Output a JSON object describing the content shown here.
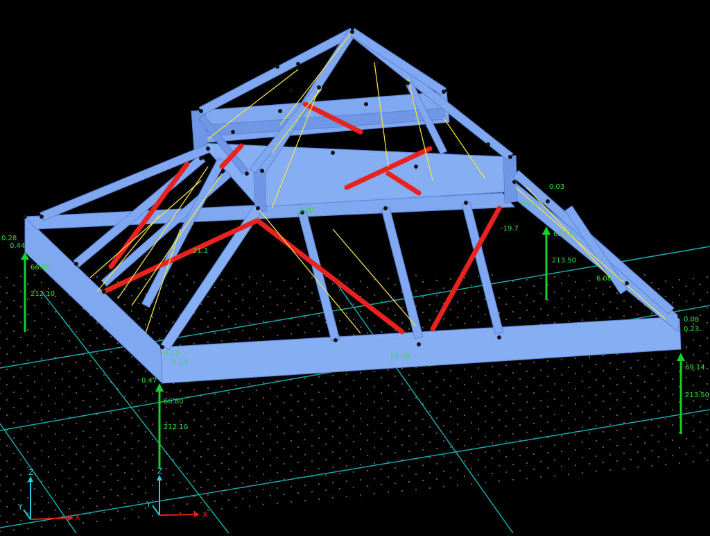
{
  "colors": {
    "background": "#000000",
    "member": "#7fa8f0",
    "member_dark": "#5b82d6",
    "bracing_red": "#e8231f",
    "cable_yellow": "#f2e34a",
    "support_green": "#18d12a",
    "label_green": "#34e040",
    "grid_line": "#1aa9a9",
    "grid_dot": "#9a9a9a",
    "axis_x": "#e0241a",
    "axis_y": "#24c9d4",
    "axis_z": "#22d2df",
    "node": "#111111"
  },
  "support_reactions": {
    "left_top": "0.28",
    "left_upper": "0.44",
    "left_mid": "66.80",
    "left_low": "212.10",
    "front_corner_a": "0.23",
    "front_corner_b": "0.23",
    "front_corner_c": "0.47",
    "front_main_1": "66.80",
    "front_main_2": "212.10",
    "right_rear_1": "0.03",
    "right_rear_2": "0.23",
    "right_rear_3": "-19.7",
    "right_rear_4": "62.14",
    "right_rear_5": "213.50",
    "right_rear_6": "6.08",
    "right_front_1": "0.08",
    "right_front_2": "0.23",
    "right_front_3": "69.14",
    "right_front_4": "213.50",
    "member_label_1": "21.1",
    "member_label_2": "19.88",
    "member_label_3": "6.60"
  },
  "axis_triads": [
    {
      "x": "X",
      "y": "Y",
      "z": "Z"
    },
    {
      "x": "X",
      "y": "Y",
      "z": "Z"
    }
  ]
}
